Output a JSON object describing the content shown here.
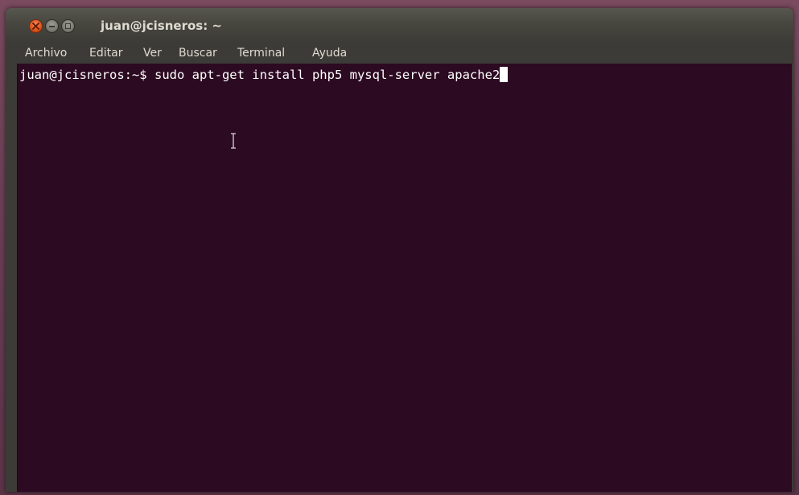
{
  "window": {
    "title": "juan@jcisneros: ~"
  },
  "menubar": {
    "items": [
      "Archivo",
      "Editar",
      "Ver",
      "Buscar",
      "Terminal",
      "Ayuda"
    ]
  },
  "terminal": {
    "prompt": "juan@jcisneros:~$ ",
    "command": "sudo apt-get install php5 mysql-server apache2"
  },
  "icons": {
    "close": "close-icon",
    "minimize": "minimize-icon",
    "maximize": "maximize-icon",
    "pointer": "text-cursor-icon"
  },
  "colors": {
    "terminal_background": "#2c0a21",
    "terminal_text": "#ffffff",
    "titlebar": "#3c3b37",
    "close_button": "#e2561c",
    "menu_text": "#dfdbd2"
  }
}
